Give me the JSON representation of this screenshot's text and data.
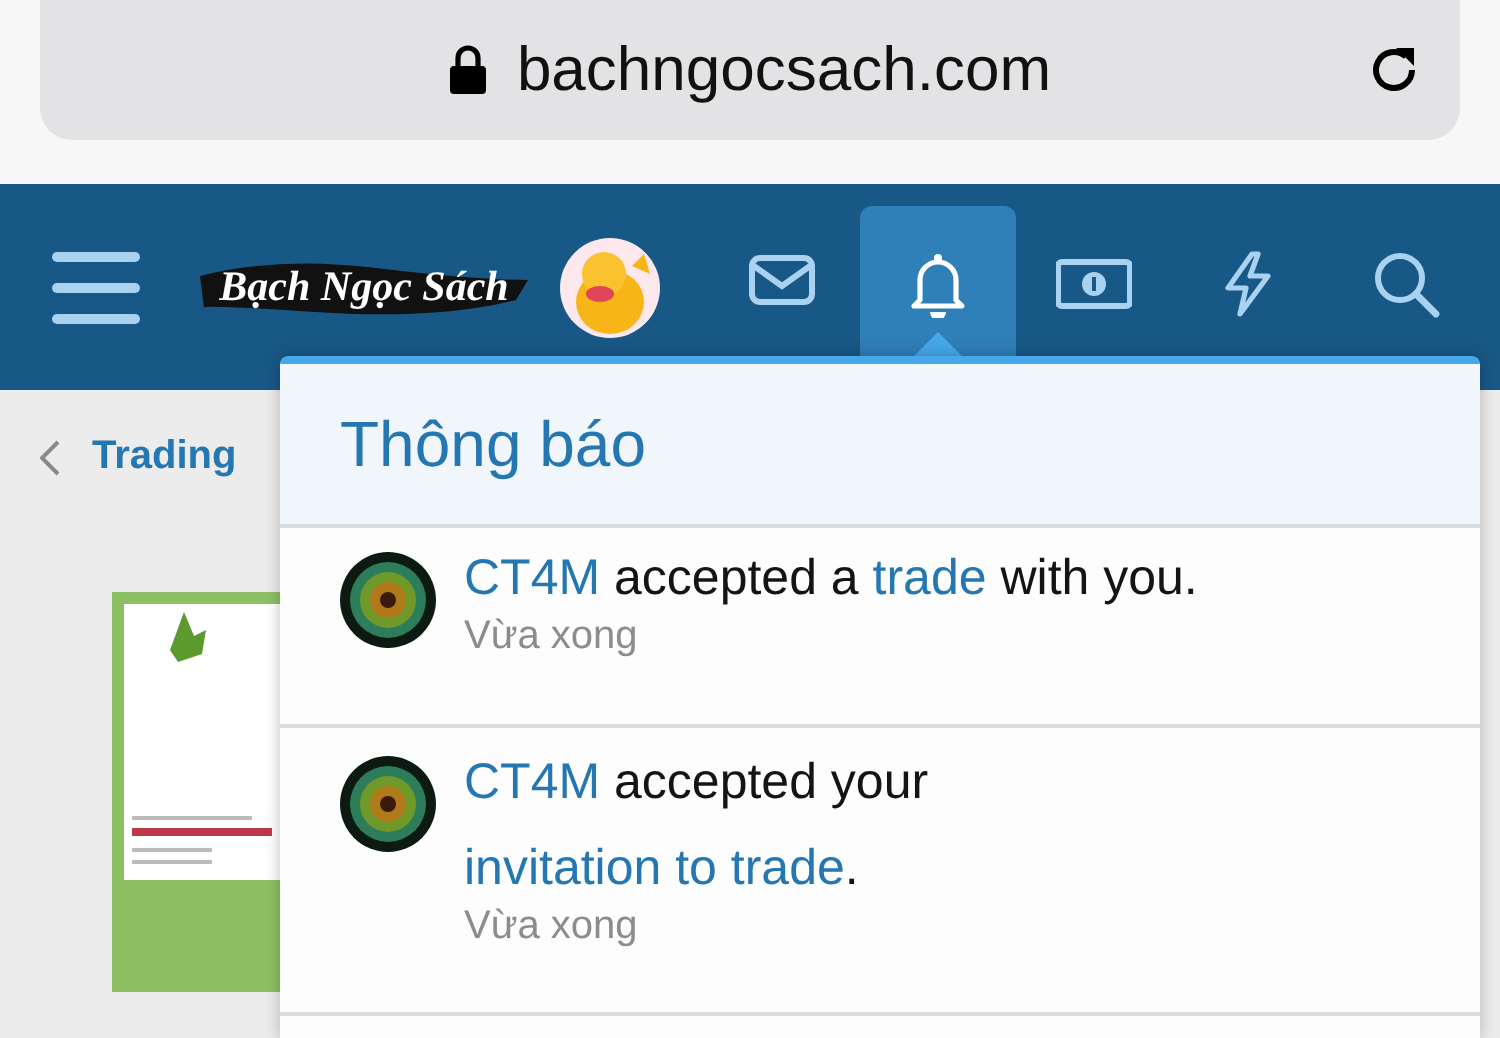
{
  "address_bar": {
    "url": "bachngocsach.com"
  },
  "nav": {
    "logo_text": "Bạch Ngọc Sách",
    "items": [
      {
        "kind": "mail",
        "selected": false
      },
      {
        "kind": "bell",
        "selected": true
      },
      {
        "kind": "money",
        "selected": false
      },
      {
        "kind": "bolt",
        "selected": false
      },
      {
        "kind": "search",
        "selected": false
      }
    ]
  },
  "breadcrumb": {
    "label": "Trading"
  },
  "notifications": {
    "title": "Thông báo",
    "items": [
      {
        "parts": [
          {
            "kind": "user",
            "text": "CT4M"
          },
          {
            "kind": "text",
            "text": " accepted a "
          },
          {
            "kind": "link",
            "text": "trade"
          },
          {
            "kind": "text",
            "text": " with you."
          }
        ],
        "time": "Vừa xong"
      },
      {
        "parts": [
          {
            "kind": "user",
            "text": "CT4M"
          },
          {
            "kind": "text",
            "text": " accepted your "
          },
          {
            "kind": "link",
            "text": "invitation to trade"
          },
          {
            "kind": "text",
            "text": "."
          }
        ],
        "time": "Vừa xong"
      }
    ]
  }
}
